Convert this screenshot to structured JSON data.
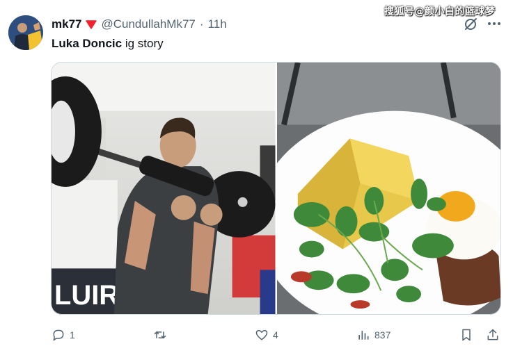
{
  "tweet": {
    "display_name": "mk77",
    "handle": "@CundullahMk77",
    "separator": "·",
    "time": "11h",
    "text_bold": "Luka Doncic",
    "text_rest": " ig story",
    "badge_color": "#f4212e"
  },
  "watermark": "搜狐号@颜小白的篮球梦",
  "images": [
    {
      "alt": "gym-photo",
      "banner_text": "LUIR"
    },
    {
      "alt": "food-photo"
    }
  ],
  "actions": {
    "reply_count": "1",
    "retweet_count": "",
    "like_count": "4",
    "views_count": "837"
  },
  "colors": {
    "text": "#0f1419",
    "secondary": "#536471",
    "border": "#cfd9de"
  }
}
